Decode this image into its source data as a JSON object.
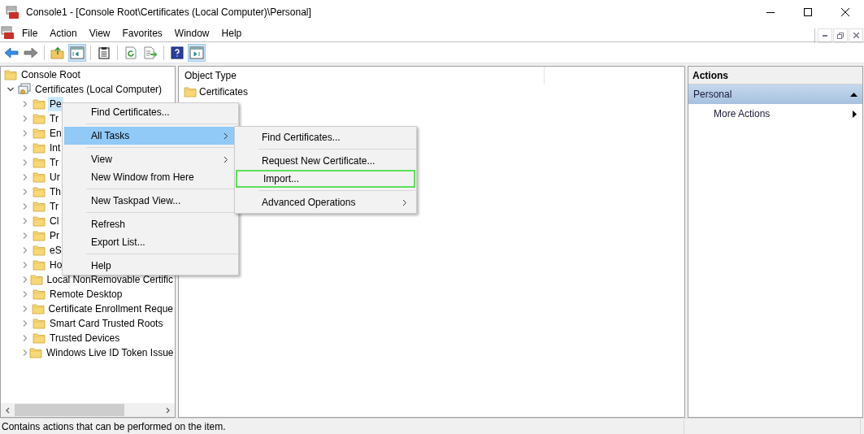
{
  "window": {
    "title": "Console1 - [Console Root\\Certificates (Local Computer)\\Personal]"
  },
  "menu_bar": [
    "File",
    "Action",
    "View",
    "Favorites",
    "Window",
    "Help"
  ],
  "toolbar": [
    {
      "kind": "back",
      "pressed": false
    },
    {
      "kind": "forward",
      "pressed": false
    },
    {
      "kind": "sep"
    },
    {
      "kind": "up",
      "pressed": false
    },
    {
      "kind": "tree",
      "pressed": true
    },
    {
      "kind": "sep"
    },
    {
      "kind": "properties",
      "pressed": false
    },
    {
      "kind": "sep"
    },
    {
      "kind": "refresh",
      "pressed": false
    },
    {
      "kind": "export",
      "pressed": false
    },
    {
      "kind": "sep"
    },
    {
      "kind": "help",
      "pressed": false
    },
    {
      "kind": "actionpane",
      "pressed": true
    }
  ],
  "tree": [
    {
      "label": "Console Root",
      "kind": "folder",
      "selected": false,
      "children": [
        {
          "label": "Certificates (Local Computer)",
          "kind": "cert",
          "expanded": true,
          "selected": false,
          "children": [
            {
              "label": "Pe",
              "kind": "folder",
              "expanded": false,
              "selected": true
            },
            {
              "label": "Tr",
              "kind": "folder",
              "expanded": false,
              "selected": false
            },
            {
              "label": "En",
              "kind": "folder",
              "expanded": false,
              "selected": false
            },
            {
              "label": "Int",
              "kind": "folder",
              "expanded": false,
              "selected": false
            },
            {
              "label": "Tr",
              "kind": "folder",
              "expanded": false,
              "selected": false
            },
            {
              "label": "Ur",
              "kind": "folder",
              "expanded": false,
              "selected": false
            },
            {
              "label": "Th",
              "kind": "folder",
              "expanded": false,
              "selected": false
            },
            {
              "label": "Tr",
              "kind": "folder",
              "expanded": false,
              "selected": false
            },
            {
              "label": "Cl",
              "kind": "folder",
              "expanded": false,
              "selected": false
            },
            {
              "label": "Pr",
              "kind": "folder",
              "expanded": false,
              "selected": false
            },
            {
              "label": "eS",
              "kind": "folder",
              "expanded": false,
              "selected": false
            },
            {
              "label": "Ho",
              "kind": "folder",
              "expanded": false,
              "selected": false
            },
            {
              "label": "Local NonRemovable Certific",
              "kind": "folder",
              "expanded": false,
              "selected": false
            },
            {
              "label": "Remote Desktop",
              "kind": "folder",
              "expanded": false,
              "selected": false
            },
            {
              "label": "Certificate Enrollment Reque",
              "kind": "folder",
              "expanded": false,
              "selected": false
            },
            {
              "label": "Smart Card Trusted Roots",
              "kind": "folder",
              "expanded": false,
              "selected": false
            },
            {
              "label": "Trusted Devices",
              "kind": "folder",
              "expanded": false,
              "selected": false
            },
            {
              "label": "Windows Live ID Token Issue",
              "kind": "folder",
              "expanded": false,
              "selected": false
            }
          ]
        }
      ]
    }
  ],
  "list": {
    "columns": [
      "Object Type"
    ],
    "rows": [
      {
        "name": "Certificates"
      }
    ]
  },
  "context_menu": [
    {
      "kind": "item",
      "label": "Find Certificates...",
      "submenu": false,
      "selected": false
    },
    {
      "kind": "separator"
    },
    {
      "kind": "item",
      "label": "All Tasks",
      "submenu": true,
      "selected": true
    },
    {
      "kind": "separator"
    },
    {
      "kind": "item",
      "label": "View",
      "submenu": true,
      "selected": false
    },
    {
      "kind": "item",
      "label": "New Window from Here",
      "submenu": false,
      "selected": false
    },
    {
      "kind": "separator"
    },
    {
      "kind": "item",
      "label": "New Taskpad View...",
      "submenu": false,
      "selected": false
    },
    {
      "kind": "separator"
    },
    {
      "kind": "item",
      "label": "Refresh",
      "submenu": false,
      "selected": false
    },
    {
      "kind": "item",
      "label": "Export List...",
      "submenu": false,
      "selected": false
    },
    {
      "kind": "separator"
    },
    {
      "kind": "item",
      "label": "Help",
      "submenu": false,
      "selected": false
    }
  ],
  "submenu": [
    {
      "kind": "item",
      "label": "Find Certificates...",
      "submenu": false,
      "outlined": false
    },
    {
      "kind": "separator"
    },
    {
      "kind": "item",
      "label": "Request New Certificate...",
      "submenu": false,
      "outlined": false
    },
    {
      "kind": "item",
      "label": "Import...",
      "submenu": false,
      "outlined": true
    },
    {
      "kind": "separator"
    },
    {
      "kind": "item",
      "label": "Advanced Operations",
      "submenu": true,
      "outlined": false
    }
  ],
  "actions": {
    "title": "Actions",
    "section": "Personal",
    "expanded": true,
    "items": [
      "More Actions"
    ]
  },
  "status_bar": "Contains actions that can be performed on the item."
}
